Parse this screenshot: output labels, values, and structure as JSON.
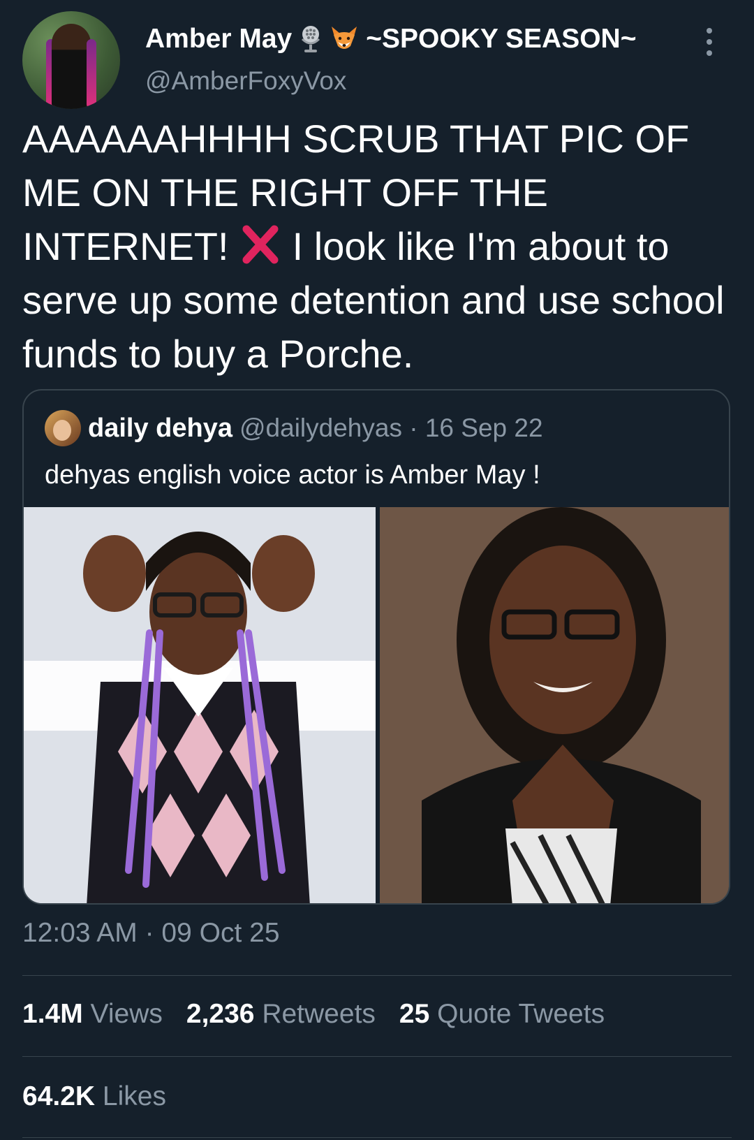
{
  "author": {
    "display_name": "Amber May",
    "season_tag": "~SPOOKY SEASON~",
    "handle": "@AmberFoxyVox",
    "icons": [
      "microphone-icon",
      "fox-icon"
    ]
  },
  "tweet": {
    "text_before": "AAAAAAHHHH SCRUB THAT PIC OF ME ON THE RIGHT OFF THE INTERNET! ",
    "text_after": " I look like I'm about to serve up some detention and use school funds to buy a Porche.",
    "emoji": "cross-mark-icon"
  },
  "quoted": {
    "name": "daily dehya",
    "handle_and_date": "@dailydehyas · 16 Sep 22",
    "text": "dehyas english voice actor is Amber May !"
  },
  "meta": {
    "timestamp": "12:03 AM · 09 Oct 25"
  },
  "stats": {
    "views_count": "1.4M",
    "views_label": "Views",
    "retweets_count": "2,236",
    "retweets_label": "Retweets",
    "quotes_count": "25",
    "quotes_label": "Quote Tweets",
    "likes_count": "64.2K",
    "likes_label": "Likes"
  },
  "colors": {
    "background": "#15202b",
    "secondary_text": "#8b98a5",
    "border": "#38444d"
  }
}
